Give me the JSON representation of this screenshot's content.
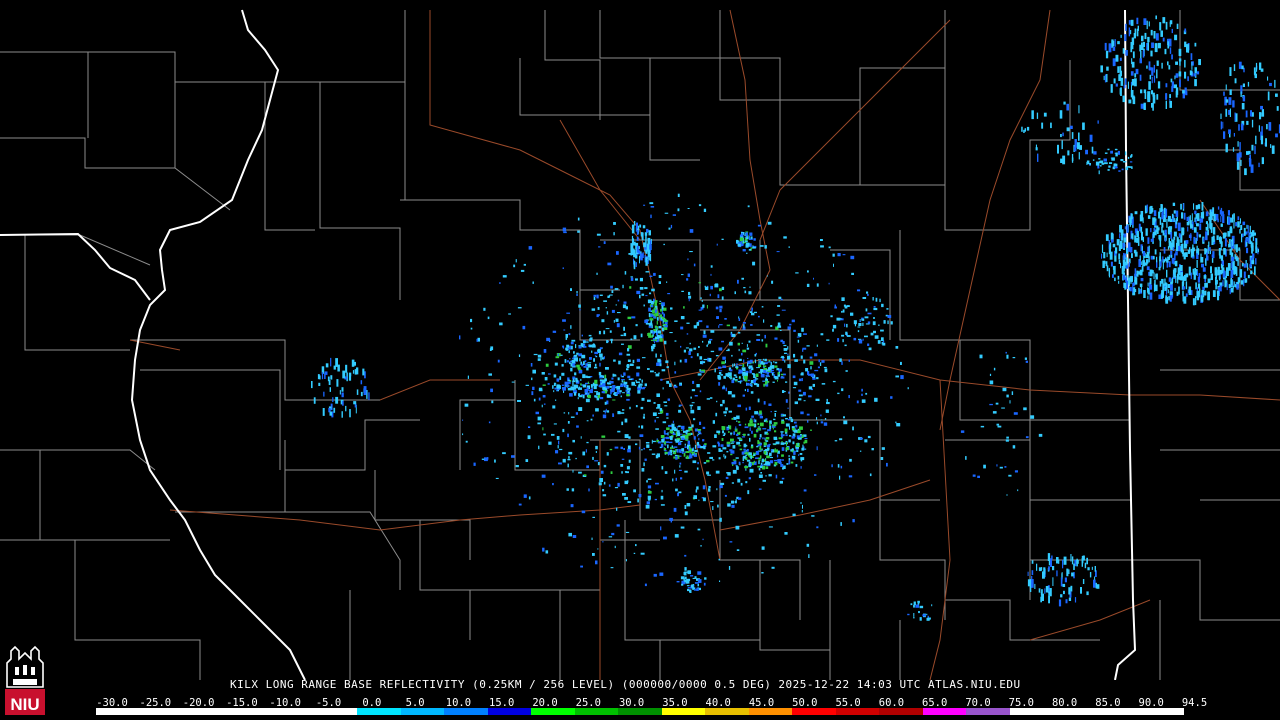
{
  "caption": "KILX LONG RANGE BASE REFLECTIVITY (0.25KM / 256 LEVEL) (000000/0000 0.5 DEG) 2025-12-22 14:03 UTC  ATLAS.NIU.EDU",
  "scale": {
    "ticks": [
      "-30.0",
      "-25.0",
      "-20.0",
      "-15.0",
      "-10.0",
      "-5.0",
      "0.0",
      "5.0",
      "10.0",
      "15.0",
      "20.0",
      "25.0",
      "30.0",
      "35.0",
      "40.0",
      "45.0",
      "50.0",
      "55.0",
      "60.0",
      "65.0",
      "70.0",
      "75.0",
      "80.0",
      "85.0",
      "90.0",
      "94.5"
    ],
    "colors": [
      "#ffffff",
      "#ffffff",
      "#ffffff",
      "#ffffff",
      "#ffffff",
      "#ffffff",
      "#00e5ff",
      "#00b8ff",
      "#0080ff",
      "#0000e0",
      "#00ff00",
      "#00c000",
      "#009000",
      "#ffff00",
      "#e8c000",
      "#ff9000",
      "#ff0000",
      "#d00000",
      "#b00000",
      "#ff00ff",
      "#9955cc",
      "#ffffff",
      "#ffffff",
      "#ffffff",
      "#ffffff"
    ]
  },
  "logo": {
    "text": "NIU",
    "colors": {
      "red": "#c8102e",
      "white": "#ffffff"
    }
  },
  "map_colors": {
    "county": "#8c8c8c",
    "state": "#ffffff",
    "road": "#9a4a2a",
    "echo_light": "#33ccff",
    "echo_mid": "#1a66ff",
    "echo_green": "#2ecc40"
  }
}
